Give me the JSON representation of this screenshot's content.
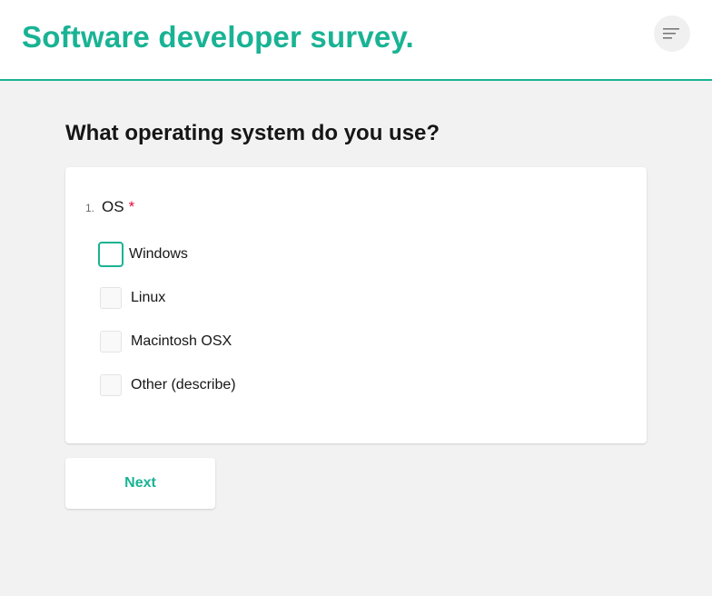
{
  "header": {
    "title": "Software developer survey.",
    "menu_icon": "hamburger-menu-icon"
  },
  "page": {
    "title": "What operating system do you use?"
  },
  "question": {
    "number": "1.",
    "title": "OS",
    "required_mark": "*",
    "options": [
      {
        "label": "Windows",
        "checked": false,
        "focused": true
      },
      {
        "label": "Linux",
        "checked": false,
        "focused": false
      },
      {
        "label": "Macintosh OSX",
        "checked": false,
        "focused": false
      },
      {
        "label": "Other (describe)",
        "checked": false,
        "focused": false
      }
    ]
  },
  "navigation": {
    "next_label": "Next"
  },
  "colors": {
    "accent": "#19b394",
    "required": "#e60a3e",
    "background": "#f2f2f2"
  }
}
